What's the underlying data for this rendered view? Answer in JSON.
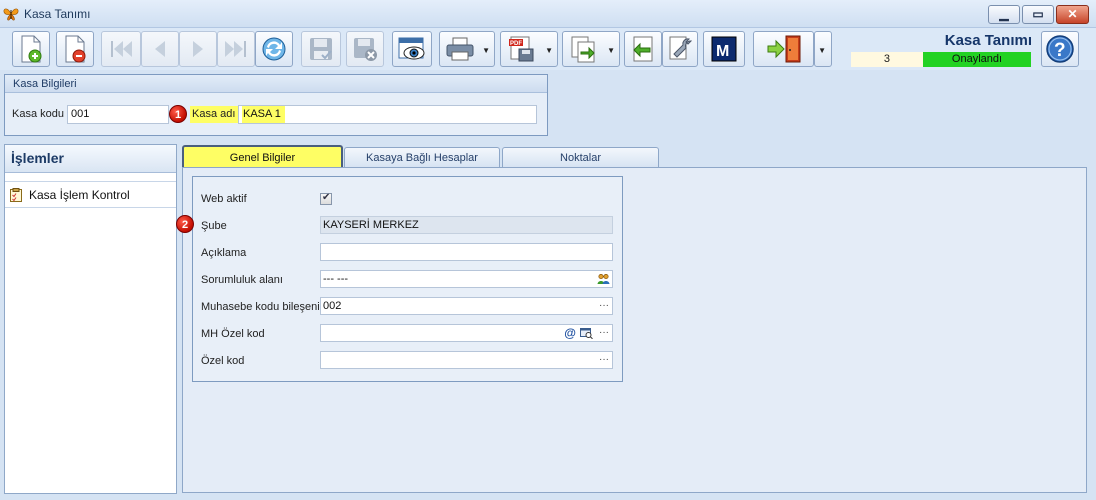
{
  "window": {
    "title": "Kasa Tanımı"
  },
  "header": {
    "form_title": "Kasa Tanımı",
    "record_number": "3",
    "status": "Onaylandı"
  },
  "kasa_bilgileri": {
    "group_title": "Kasa Bilgileri",
    "kasa_kodu_label": "Kasa kodu",
    "kasa_kodu_value": "001",
    "kasa_adi_label": "Kasa adı",
    "kasa_adi_value": "KASA 1",
    "badge_1": "1"
  },
  "islemler": {
    "title": "İşlemler",
    "items": [
      {
        "label": "Kasa İşlem Kontrol"
      }
    ]
  },
  "tabs": [
    {
      "label": "Genel Bilgiler",
      "active": true
    },
    {
      "label": "Kasaya Bağlı Hesaplar",
      "active": false
    },
    {
      "label": "Noktalar",
      "active": false
    }
  ],
  "genel_bilgiler": {
    "web_aktif_label": "Web aktif",
    "web_aktif_checked": true,
    "sube_label": "Şube",
    "sube_value": "KAYSERİ MERKEZ",
    "badge_2": "2",
    "aciklama_label": "Açıklama",
    "aciklama_value": "",
    "sorumluluk_label": "Sorumluluk alanı",
    "sorumluluk_value": "--- ---",
    "muhasebe_label": "Muhasebe kodu bileşeni",
    "muhasebe_value": "002",
    "mh_ozel_label": "MH Özel kod",
    "mh_ozel_value": "",
    "ozel_kod_label": "Özel kod",
    "ozel_kod_value": "",
    "ellipsis": "···"
  },
  "toolbar_icons": [
    "new-document-icon",
    "delete-document-icon",
    "first-record-icon",
    "previous-record-icon",
    "next-record-icon",
    "last-record-icon",
    "refresh-icon",
    "save-icon",
    "save-close-icon",
    "preview-icon",
    "print-icon",
    "pdf-export-icon",
    "copy-icon",
    "import-icon",
    "settings-wrench-icon",
    "m-icon",
    "exit-door-icon",
    "help-icon"
  ],
  "colors": {
    "highlight": "#fefe64",
    "status_green": "#23d223",
    "title_blue": "#16366a",
    "badge_red": "#c20d00"
  }
}
